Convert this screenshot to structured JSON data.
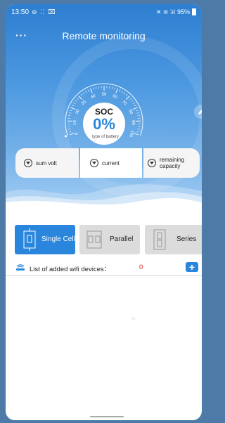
{
  "status_bar": {
    "time": "13:50",
    "left_icons": "⊖ ⁚⁚ ⌧",
    "right_icons": "✕ ≋ ⁞ıl",
    "battery": "95%"
  },
  "header": {
    "menu_icon": "more-dots-icon",
    "title": "Remote monitoring"
  },
  "gauge": {
    "ticks": [
      "0",
      "10",
      "20",
      "30",
      "40",
      "50",
      "60",
      "70",
      "80",
      "90",
      "100"
    ],
    "soc_label": "SOC",
    "soc_value": "0%",
    "soc_fraction": 0,
    "type_label": "type of battery",
    "type_value": "-"
  },
  "cards": [
    {
      "label": "sum volt",
      "icon": "gauge-icon"
    },
    {
      "label": "current",
      "icon": "gauge-icon"
    },
    {
      "label": "remaining capacity",
      "icon": "gauge-icon"
    }
  ],
  "modes": [
    {
      "label": "Single Cell",
      "selected": true
    },
    {
      "label": "Parallel",
      "selected": false
    },
    {
      "label": "Series",
      "selected": false
    }
  ],
  "wifi": {
    "label": "List of added wifi devices：",
    "count": "0",
    "add_icon": "plus-icon"
  },
  "colors": {
    "accent": "#2a86dc",
    "count": "#d62020",
    "background": "#4d7aa6"
  }
}
